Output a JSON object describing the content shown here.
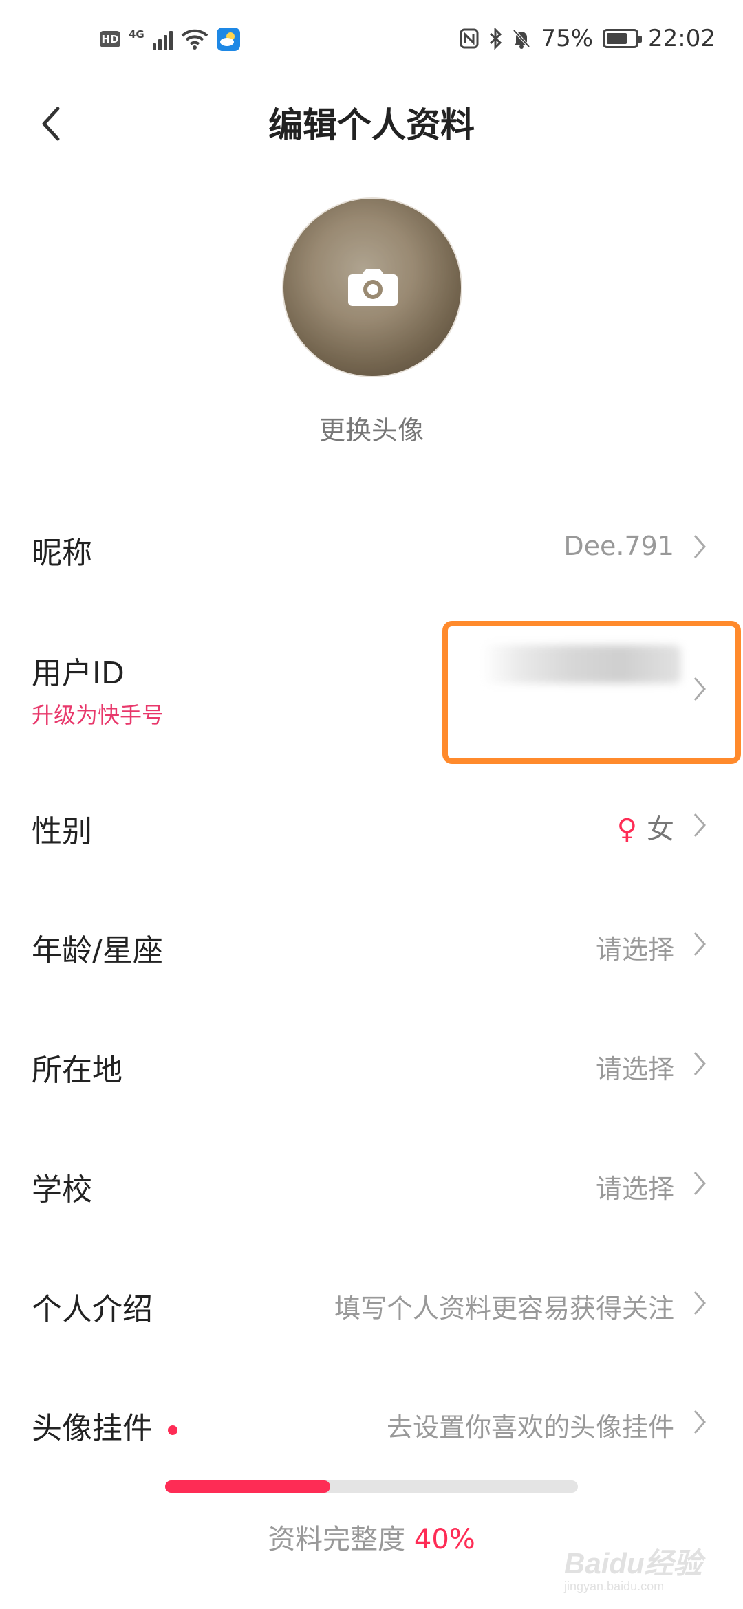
{
  "status_bar": {
    "hd": "HD",
    "network": "4G",
    "battery_percent": "75%",
    "battery_level": 0.75,
    "time": "22:02"
  },
  "header": {
    "title": "编辑个人资料"
  },
  "avatar": {
    "change_label": "更换头像"
  },
  "profile": {
    "nickname": {
      "label": "昵称",
      "value": "Dee.791"
    },
    "user_id": {
      "label": "用户ID",
      "upgrade": "升级为快手号"
    },
    "gender": {
      "label": "性别",
      "symbol": "♀",
      "value": "女"
    },
    "age": {
      "label": "年龄/星座",
      "value": "请选择"
    },
    "location": {
      "label": "所在地",
      "value": "请选择"
    },
    "school": {
      "label": "学校",
      "value": "请选择"
    },
    "bio": {
      "label": "个人介绍",
      "value": "填写个人资料更容易获得关注"
    },
    "pendant": {
      "label": "头像挂件",
      "value": "去设置你喜欢的头像挂件"
    }
  },
  "completeness": {
    "label": "资料完整度",
    "percent_text": "40%",
    "fraction": 0.4
  },
  "watermark": {
    "brand": "Baidu经验",
    "url": "jingyan.baidu.com"
  },
  "colors": {
    "accent": "#fe2c55",
    "highlight": "#ff8a2c",
    "muted_text": "#999999"
  }
}
